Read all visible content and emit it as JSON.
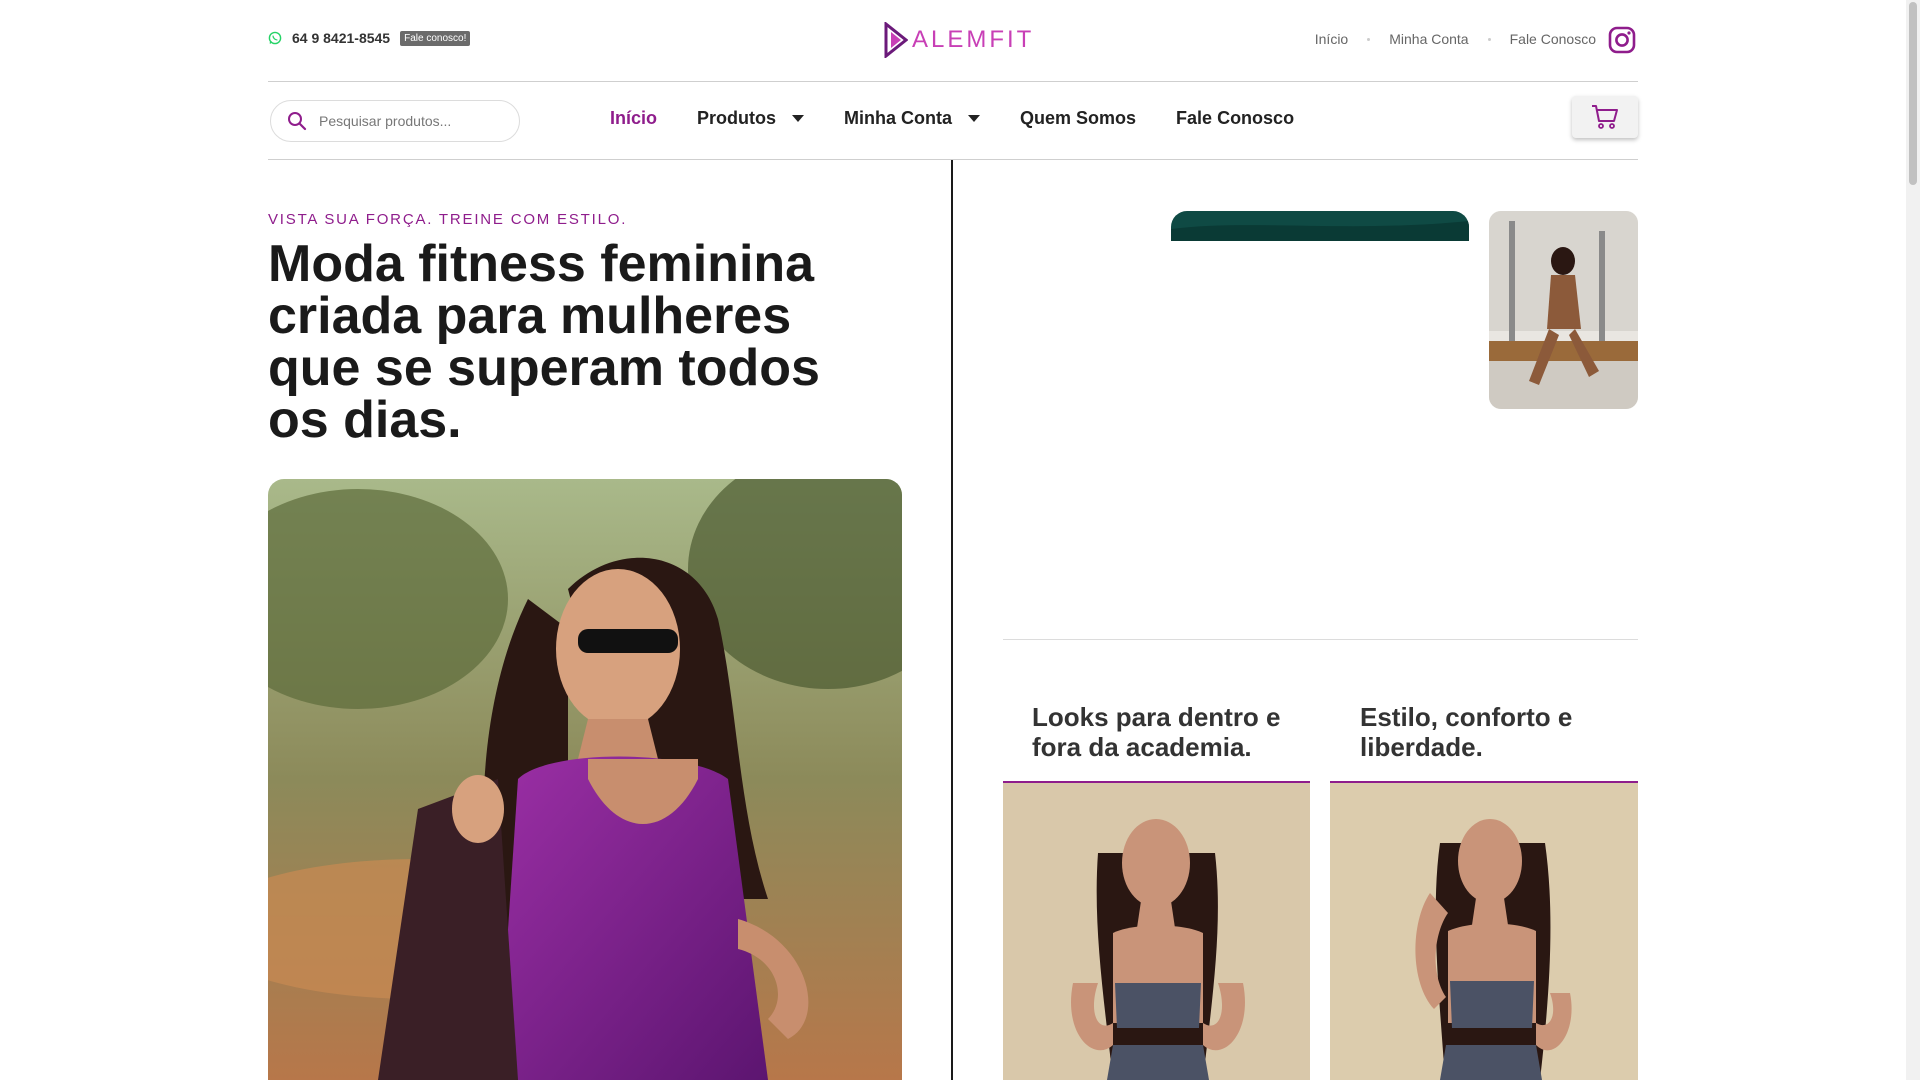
{
  "topbar": {
    "phone": "64 9 8421-8545",
    "contact_badge": "Fale conosco!",
    "logo_text": "ALEMFIT",
    "links": [
      "Início",
      "Minha Conta",
      "Fale Conosco"
    ]
  },
  "search": {
    "placeholder": "Pesquisar produtos..."
  },
  "nav": {
    "items": [
      {
        "label": "Início",
        "active": true
      },
      {
        "label": "Produtos",
        "dropdown": true
      },
      {
        "label": "Minha Conta",
        "dropdown": true
      },
      {
        "label": "Quem Somos"
      },
      {
        "label": "Fale Conosco"
      }
    ]
  },
  "hero": {
    "tagline": "VISTA SUA FORÇA. TREINE COM ESTILO.",
    "title": "Moda fitness feminina criada para mulheres que se superam todos os dias."
  },
  "cards": [
    {
      "title": "Looks para dentro e fora da academia."
    },
    {
      "title": "Estilo, conforto e liberdade."
    }
  ],
  "colors": {
    "accent": "#8f1d8c",
    "logo": "#c83fb6",
    "whatsapp": "#25d366"
  },
  "icons": [
    "whatsapp-icon",
    "instagram-icon",
    "search-icon",
    "cart-icon",
    "chevron-down-icon"
  ]
}
